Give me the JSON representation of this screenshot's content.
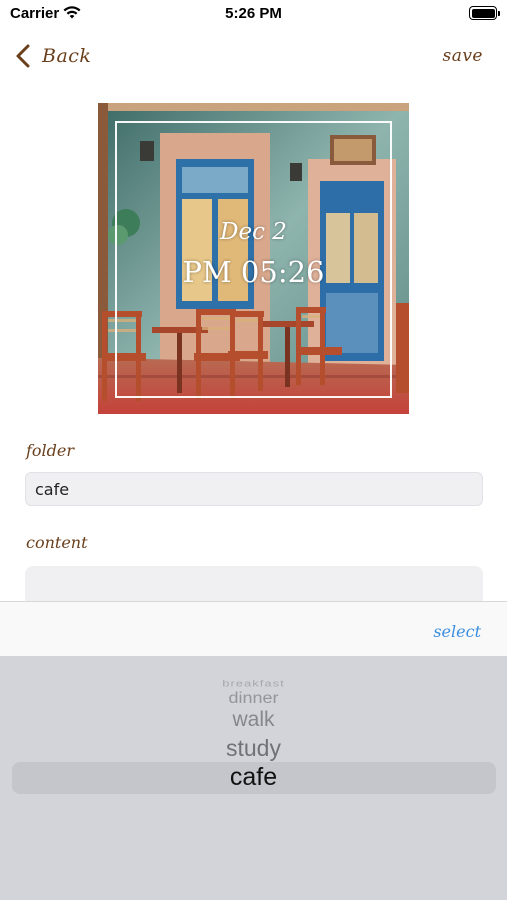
{
  "status_bar": {
    "carrier": "Carrier",
    "time": "5:26 PM",
    "wifi_icon": "wifi-icon",
    "battery_icon": "battery-icon"
  },
  "nav": {
    "back_label": "Back",
    "save_label": "save",
    "back_icon": "chevron-left-icon"
  },
  "photo": {
    "date": "Dec 2",
    "time": "PM 05:26"
  },
  "form": {
    "folder_label": "folder",
    "folder_value": "cafe",
    "content_label": "content",
    "content_value": ""
  },
  "picker": {
    "select_label": "select",
    "items": [
      "breakfast",
      "dinner",
      "walk",
      "study",
      "cafe"
    ],
    "selected": "cafe"
  },
  "colors": {
    "accent": "#6a3f1c",
    "select": "#3b8ee0",
    "picker_bg": "#d2d4da"
  }
}
